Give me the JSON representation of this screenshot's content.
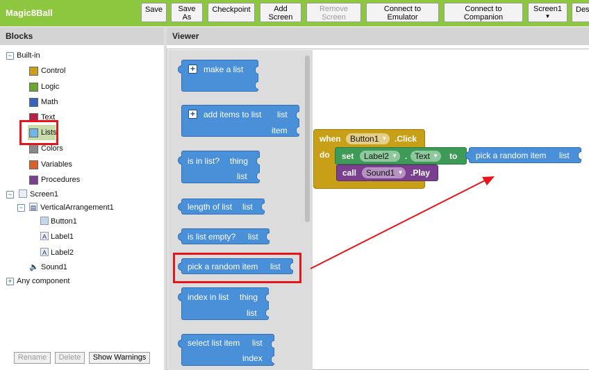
{
  "app": {
    "title": "Magic8Ball"
  },
  "toolbar": {
    "save": "Save",
    "save_as": [
      "Save",
      "As"
    ],
    "checkpoint": "Checkpoint",
    "add_screen": [
      "Add",
      "Screen"
    ],
    "remove_screen": [
      "Remove",
      "Screen"
    ],
    "connect_emulator": [
      "Connect to",
      "Emulator"
    ],
    "connect_companion": [
      "Connect to",
      "Companion"
    ],
    "screen_select": "Screen1",
    "designer": "Des"
  },
  "blocks_panel": {
    "header": "Blocks",
    "builtin": "Built-in",
    "categories": [
      {
        "label": "Control",
        "color": "#c8a018"
      },
      {
        "label": "Logic",
        "color": "#6aa530"
      },
      {
        "label": "Math",
        "color": "#3a64b8"
      },
      {
        "label": "Text",
        "color": "#b5214d"
      },
      {
        "label": "Lists",
        "color": "#6fb6e8"
      },
      {
        "label": "Colors",
        "color": "#8a8a8a"
      },
      {
        "label": "Variables",
        "color": "#d9622b"
      },
      {
        "label": "Procedures",
        "color": "#7b3f8f"
      }
    ],
    "screen": "Screen1",
    "arrangement": "VerticalArrangement1",
    "components": [
      "Button1",
      "Label1",
      "Label2"
    ],
    "sound": "Sound1",
    "any_component": "Any component",
    "rename": "Rename",
    "delete": "Delete",
    "show_warnings": "Show Warnings"
  },
  "viewer": {
    "header": "Viewer",
    "flyout": {
      "make_a_list": "make a list",
      "add_items": "add items to list",
      "add_items_list": "list",
      "add_items_item": "item",
      "is_in_list": "is in list?",
      "is_in_list_thing": "thing",
      "is_in_list_list": "list",
      "length_of_list": "length of list",
      "length_of_list_list": "list",
      "is_list_empty": "is list empty?",
      "is_list_empty_list": "list",
      "pick_random": "pick a random item",
      "pick_random_list": "list",
      "index_in_list": "index in list",
      "index_in_list_thing": "thing",
      "index_in_list_list": "list",
      "select_list_item": "select list item",
      "select_list_item_list": "list",
      "select_list_item_index": "index"
    },
    "workspace": {
      "when": "when",
      "event_component": "Button1",
      "event_name": ".Click",
      "do": "do",
      "set": "set",
      "set_component": "Label2",
      "dot": ".",
      "set_property": "Text",
      "to": "to",
      "call": "call",
      "call_component": "Sound1",
      "call_method": ".Play",
      "pick_random": "pick a random item",
      "pick_random_list": "list"
    }
  },
  "colors": {
    "topbar": "#8dc63f",
    "list_block": "#4a90d9",
    "event_block": "#c8a018",
    "set_block": "#3d9b57",
    "call_block": "#7b3f8f",
    "highlight": "#e8141a"
  }
}
